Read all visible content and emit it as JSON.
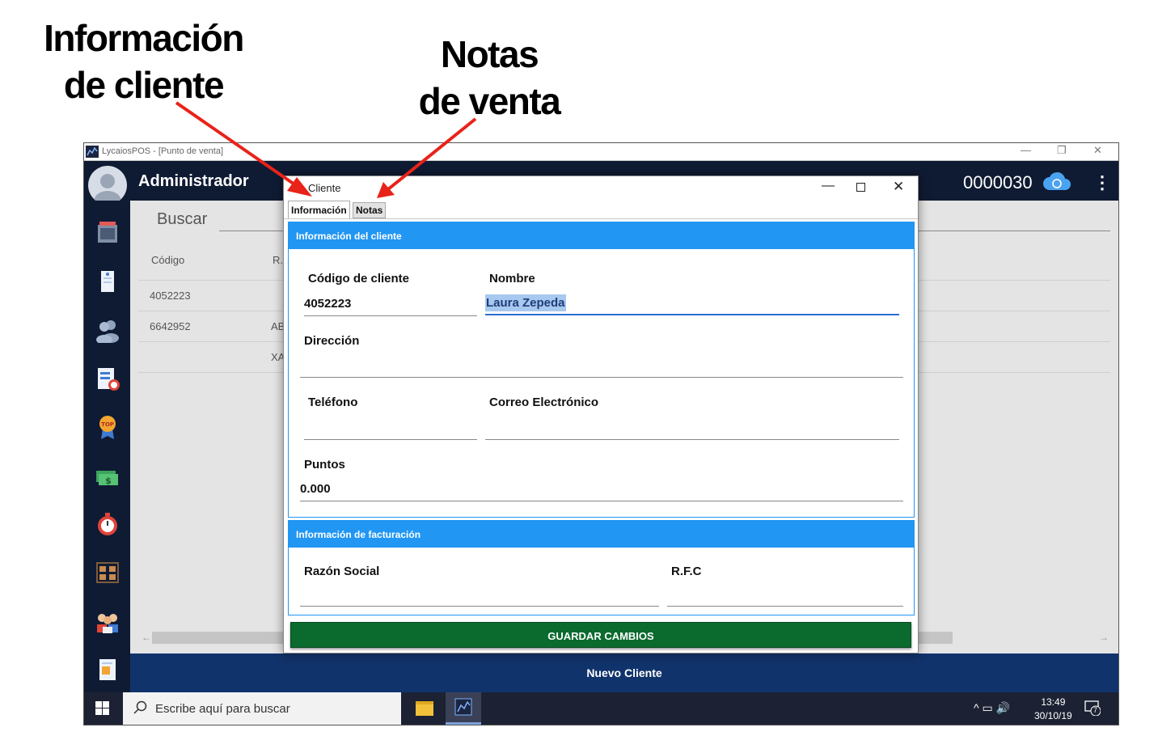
{
  "annotations": {
    "info_line1": "Información",
    "info_line2": "de cliente",
    "notas_line1": "Notas",
    "notas_line2": "de venta"
  },
  "app": {
    "window_title": "LycaiosPOS - [Punto de venta]",
    "user_name": "Administrador",
    "folio": "0000030",
    "search_label": "Buscar",
    "table": {
      "columns": [
        "Código",
        "R."
      ],
      "rows": [
        {
          "codigo": "4052223",
          "rfc": ""
        },
        {
          "codigo": "6642952",
          "rfc": "AB"
        },
        {
          "codigo": "",
          "rfc": "XA"
        }
      ]
    },
    "new_client_button": "Nuevo Cliente",
    "sidebar_icons": [
      "calculator-icon",
      "notepad-icon",
      "users-icon",
      "report-icon",
      "top-badge-icon",
      "money-icon",
      "stopwatch-icon",
      "warehouse-icon",
      "team-icon",
      "document-icon"
    ]
  },
  "taskbar": {
    "search_placeholder": "Escribe aquí para buscar",
    "time": "13:49",
    "date": "30/10/19",
    "notifications": "7"
  },
  "dialog": {
    "title": "Cliente",
    "tabs": [
      "Información",
      "Notas"
    ],
    "section_client": "Información del cliente",
    "section_billing": "Información de facturación",
    "fields": {
      "codigo_label": "Código de cliente",
      "codigo_value": "4052223",
      "nombre_label": "Nombre",
      "nombre_value": "Laura Zepeda",
      "direccion_label": "Dirección",
      "direccion_value": "",
      "telefono_label": "Teléfono",
      "telefono_value": "",
      "correo_label": "Correo Electrónico",
      "correo_value": "",
      "puntos_label": "Puntos",
      "puntos_value": "0.000",
      "razon_label": "Razón Social",
      "razon_value": "",
      "rfc_label": "R.F.C",
      "rfc_value": ""
    },
    "save_button": "GUARDAR CAMBIOS"
  },
  "colors": {
    "header_bg": "#0f1b33",
    "section_blue": "#2196f3",
    "save_green": "#0b6b2e",
    "footer_blue": "#11336b",
    "arrow_red": "#e8231a"
  }
}
